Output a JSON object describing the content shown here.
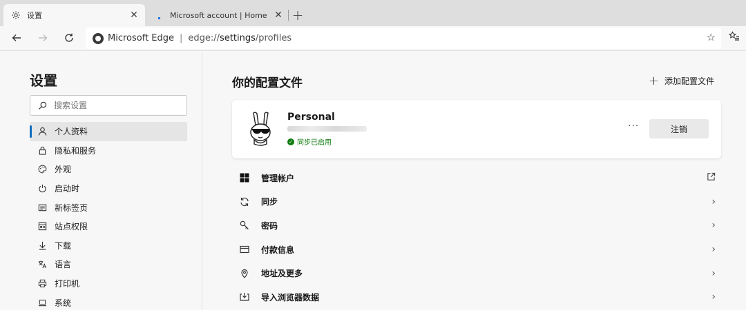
{
  "tabs": [
    {
      "title": "设置",
      "icon": "gear-icon"
    },
    {
      "title": "Microsoft account | Home",
      "icon": "microsoft-icon"
    }
  ],
  "newtab_label": "+",
  "address": {
    "site": "Microsoft Edge",
    "divider": "|",
    "url_prefix": "edge://",
    "url_host": "settings",
    "url_path": "/profiles"
  },
  "sidebar": {
    "title": "设置",
    "search_placeholder": "搜索设置",
    "items": [
      {
        "label": "个人资料",
        "icon": "person-icon",
        "selected": true
      },
      {
        "label": "隐私和服务",
        "icon": "lock-icon"
      },
      {
        "label": "外观",
        "icon": "palette-icon"
      },
      {
        "label": "启动时",
        "icon": "power-icon"
      },
      {
        "label": "新标签页",
        "icon": "newtab-icon"
      },
      {
        "label": "站点权限",
        "icon": "site-permissions-icon"
      },
      {
        "label": "下载",
        "icon": "download-icon"
      },
      {
        "label": "语言",
        "icon": "language-icon"
      },
      {
        "label": "打印机",
        "icon": "printer-icon"
      },
      {
        "label": "系统",
        "icon": "laptop-icon"
      }
    ]
  },
  "main": {
    "title": "你的配置文件",
    "add_profile_label": "添加配置文件",
    "profile": {
      "name": "Personal",
      "sync_status": "同步已启用",
      "more_label": "···",
      "signout_label": "注销"
    },
    "rows": [
      {
        "label": "管理帐户",
        "icon": "windows-grid-icon",
        "trailing": "external-link-icon"
      },
      {
        "label": "同步",
        "icon": "sync-icon",
        "trailing": "chevron-right-icon"
      },
      {
        "label": "密码",
        "icon": "key-icon",
        "trailing": "chevron-right-icon"
      },
      {
        "label": "付款信息",
        "icon": "credit-card-icon",
        "trailing": "chevron-right-icon"
      },
      {
        "label": "地址及更多",
        "icon": "location-pin-icon",
        "trailing": "chevron-right-icon"
      },
      {
        "label": "导入浏览器数据",
        "icon": "import-icon",
        "trailing": "chevron-right-icon"
      }
    ]
  },
  "colors": {
    "accent": "#0f6cbd",
    "sync_green": "#107c10"
  }
}
